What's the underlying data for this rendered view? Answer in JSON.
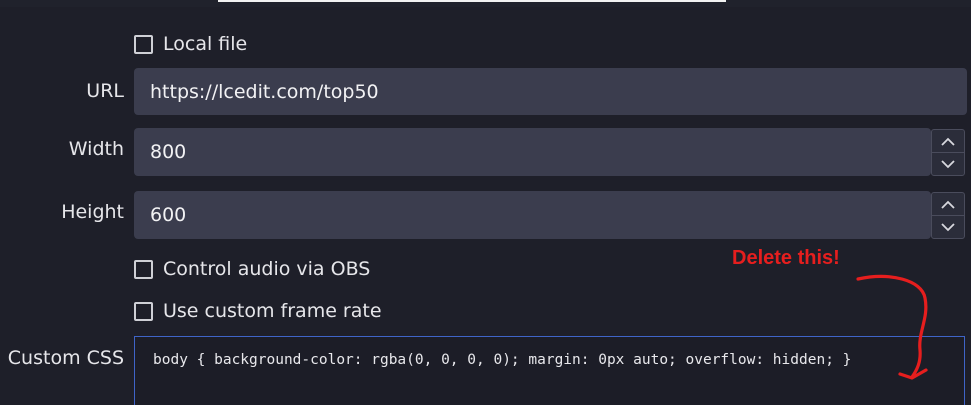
{
  "browser_source": {
    "local_file": {
      "label": "Local file",
      "checked": false
    },
    "url": {
      "label": "URL",
      "value": "https://lcedit.com/top50"
    },
    "width": {
      "label": "Width",
      "value": "800"
    },
    "height": {
      "label": "Height",
      "value": "600"
    },
    "control_audio": {
      "label": "Control audio via OBS",
      "checked": false
    },
    "custom_frame_rate": {
      "label": "Use custom frame rate",
      "checked": false
    },
    "custom_css": {
      "label": "Custom CSS",
      "value": "body { background-color: rgba(0, 0, 0, 0); margin: 0px auto; overflow: hidden; }"
    }
  },
  "annotation": {
    "text": "Delete this!",
    "color": "#e61e1e"
  },
  "icons": {
    "increment": "chevron-up-icon",
    "decrement": "chevron-down-icon"
  }
}
